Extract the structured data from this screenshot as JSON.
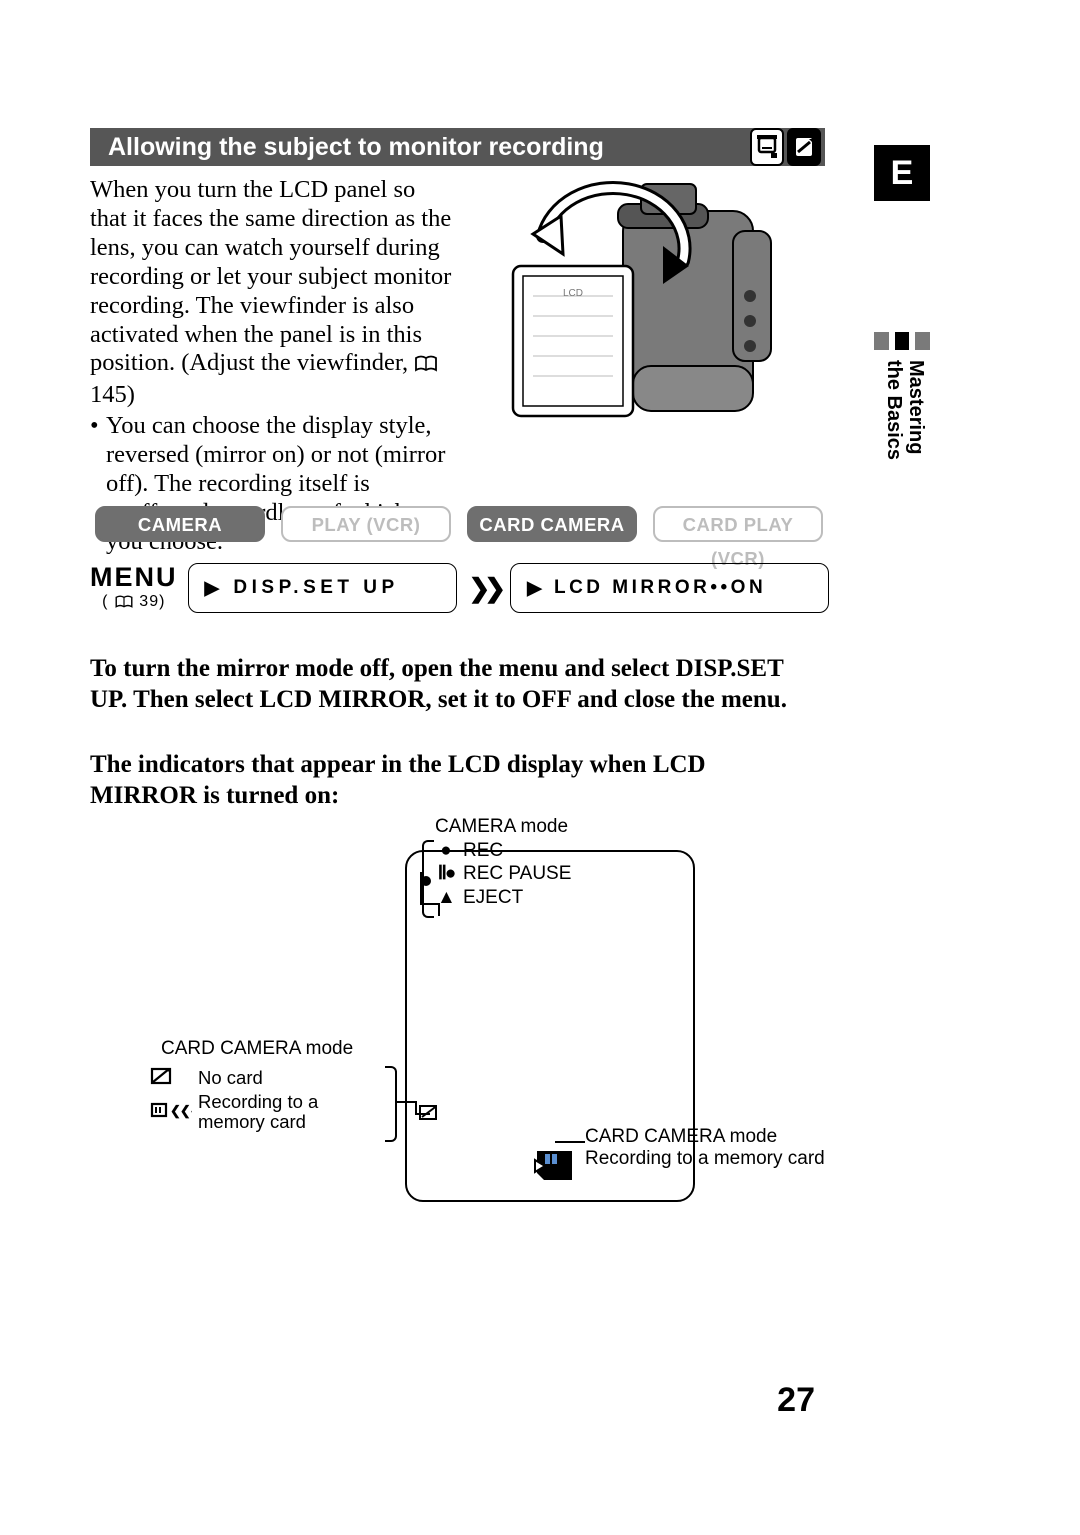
{
  "heading": "Allowing the subject to monitor recording",
  "side_marker": "E",
  "side_chapter": "Mastering\nthe Basics",
  "body": {
    "para": "When you turn the LCD panel so that it faces the same direction as the lens, you can watch yourself during recording or let your subject monitor recording. The viewfinder is also activated when the panel is in this position. (Adjust the viewfinder,",
    "page_ref": "145)",
    "bullet": "You can choose the display style, reversed (mirror on) or not (mirror off). The recording itself is unaffected regardless of which one you choose."
  },
  "modes": {
    "camera": "CAMERA",
    "play_vcr": "PLAY (VCR)",
    "card_camera": "CARD CAMERA",
    "card_play_vcr": "CARD PLAY (VCR)"
  },
  "menu": {
    "label": "MENU",
    "ref": "39",
    "step1": "DISP.SET UP",
    "step2": "LCD MIRROR••ON"
  },
  "instruction1": "To turn the mirror mode off, open the menu and select DISP.SET UP. Then select LCD MIRROR, set it to OFF and close the menu.",
  "instruction2": "The indicators that appear in the LCD display when LCD MIRROR is turned on:",
  "diagram": {
    "camera_mode_title": "CAMERA mode",
    "rec": "REC",
    "rec_pause": "REC PAUSE",
    "eject": "EJECT",
    "card_mode_title_left": "CARD CAMERA mode",
    "no_card": "No card",
    "recording_to_a": "Recording to a",
    "memory_card": "memory card",
    "card_mode_title_right": "CARD CAMERA mode",
    "recording_right": "Recording to a memory card"
  },
  "page_number": "27"
}
